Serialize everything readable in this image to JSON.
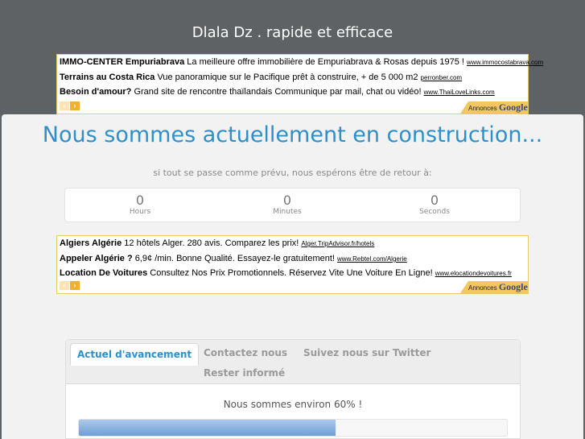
{
  "site": {
    "title": "Dlala Dz . rapide et efficace"
  },
  "ads_top": {
    "lines": [
      {
        "bold": "IMMO-CENTER Empuriabrava",
        "text": " La meilleure offre immobilière de Empuriabrava & Rosas depuis 1975 ! ",
        "url": "www.immocostabrava.com"
      },
      {
        "bold": "Terrains au Costa Rica",
        "text": " Vue panoramique sur le Pacifique prêt à construire, + de 5 000 m2 ",
        "url": "perronber.com"
      },
      {
        "bold": "Besoin d'amour?",
        "text": " Grand site de rencontre thaïlandais Communique par mail, chat ou vidéo! ",
        "url": "www.ThaiLoveLinks.com"
      }
    ],
    "prev": "‹",
    "next": "›",
    "choices_label": "Annonces ",
    "choices_brand": "Google"
  },
  "main": {
    "headline": "Nous sommes actuellement en construction...",
    "subline": "si tout se passe comme prévu, nous espérons être de retour à:"
  },
  "countdown": {
    "hours": {
      "value": "0",
      "label": "Hours"
    },
    "minutes": {
      "value": "0",
      "label": "Minutes"
    },
    "seconds": {
      "value": "0",
      "label": "Seconds"
    }
  },
  "ads_mid": {
    "lines": [
      {
        "bold": "Algiers Algérie",
        "text": " 12 hôtels Alger. 280 avis. Comparez les prix! ",
        "url": "Alger.TripAdvisor.fr/hotels"
      },
      {
        "bold": "Appeler Algérie ?",
        "text": " 6,9¢ /min. Bonne Qualité. Essayez-le gratuitement! ",
        "url": "www.Rebtel.com/Algerie"
      },
      {
        "bold": "Location De Voitures",
        "text": " Consultez Nos Prix Promotionnels. Réservez Vite Une Voiture En Ligne! ",
        "url": "www.elocationdevoitures.fr"
      }
    ],
    "prev": "‹",
    "next": "›",
    "choices_label": "Annonces ",
    "choices_brand": "Google"
  },
  "tabs": {
    "items": [
      "Actuel d'avancement",
      "Contactez nous",
      "Suivez nous sur Twitter",
      "Rester informé"
    ],
    "active_index": 0
  },
  "progress": {
    "text": "Nous sommes environ 60% !",
    "value": 0.6
  },
  "colors": {
    "accent": "#2e8fc9",
    "background": "#5f6265",
    "progress_fill": "#6f9fd4"
  }
}
